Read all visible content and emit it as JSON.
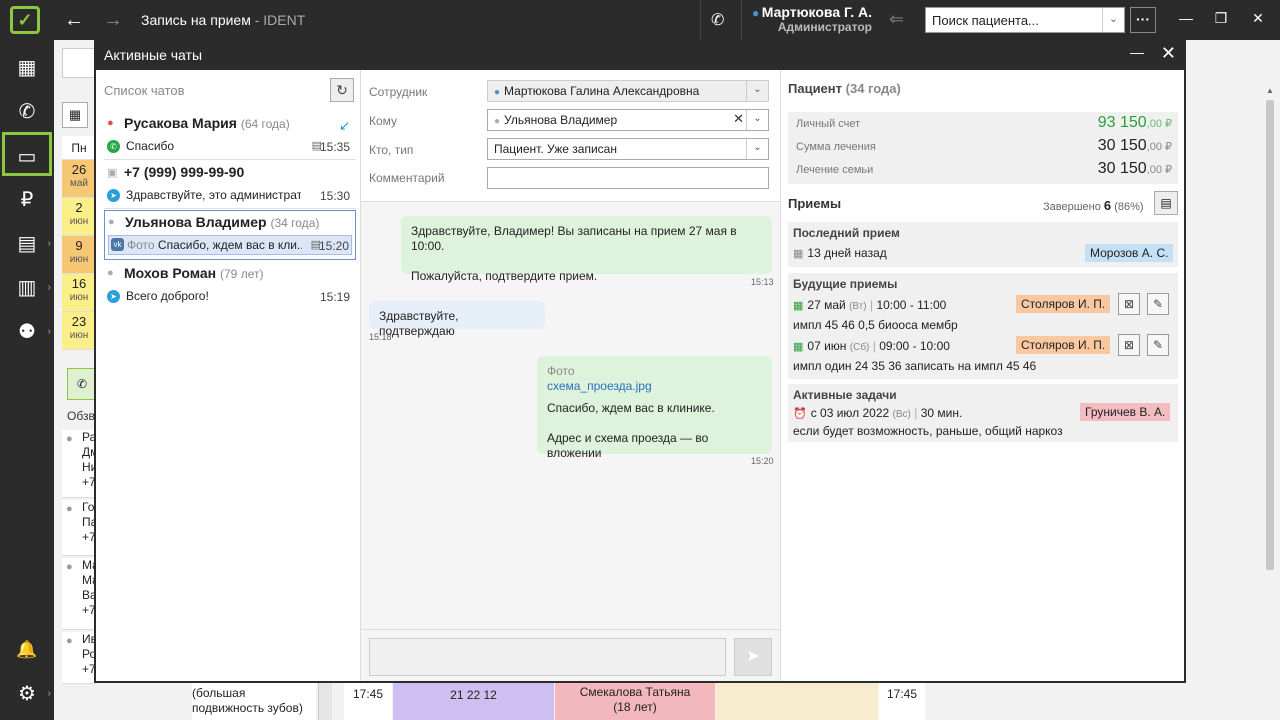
{
  "topbar": {
    "logo": "✓",
    "back_arrow": "←",
    "forward_arrow": "→",
    "title": "Запись на прием",
    "title_sub": " - IDENT",
    "user_name": "Мартюкова Г. А.",
    "user_role": "Администратор",
    "search_placeholder": "Поиск пациента...",
    "more": "···",
    "minimize": "—",
    "restore": "❐",
    "close": "✕"
  },
  "sidebar": {
    "items": [
      {
        "name": "calendar-icon",
        "glyph": "▦"
      },
      {
        "name": "calls-icon",
        "glyph": "✆"
      },
      {
        "name": "chat-icon",
        "glyph": "▭"
      },
      {
        "name": "payments-icon",
        "glyph": "₽"
      },
      {
        "name": "schedule-icon",
        "glyph": "▤"
      },
      {
        "name": "reports-icon",
        "glyph": "▥"
      },
      {
        "name": "users-icon",
        "glyph": "⚉"
      },
      {
        "name": "bell-icon",
        "glyph": "🔔"
      },
      {
        "name": "settings-icon",
        "glyph": "⚙"
      }
    ]
  },
  "background": {
    "week_day_header": "Пн",
    "days": [
      {
        "d": "26",
        "m": "май",
        "color": "#f7c873"
      },
      {
        "d": "2",
        "m": "июн",
        "color": "#fbef8a"
      },
      {
        "d": "9",
        "m": "июн",
        "color": "#f7c873"
      },
      {
        "d": "16",
        "m": "июн",
        "color": "#fbef8a"
      },
      {
        "d": "23",
        "m": "июн",
        "color": "#fbef8a"
      }
    ],
    "overview_label": "Обзв",
    "list_items": [
      {
        "lines": [
          "Ра",
          "Дм",
          "Ни",
          "+7"
        ]
      },
      {
        "lines": [
          "Го",
          "Па",
          "+7"
        ]
      },
      {
        "lines": [
          "Ма",
          "Ма",
          "Ва",
          "+7"
        ]
      },
      {
        "lines": [
          "Ив",
          "Ро",
          "+7"
        ]
      }
    ],
    "bottom_note_1": "(большая",
    "bottom_note_2": "подвижность зубов)",
    "sched_time_1": "17:45",
    "sched_cell_1": "21 22 12",
    "sched_cell_2": "Смекалова Татьяна",
    "sched_cell_2_sub": "(18 лет)",
    "sched_time_2": "17:45"
  },
  "dialog": {
    "title": "Активные чаты",
    "minimize": "—",
    "close": "✕"
  },
  "chat_list": {
    "header": "Список чатов",
    "refresh": "↻",
    "items": [
      {
        "name": "Русакова Мария",
        "age": "(64 года)",
        "channel": "whatsapp",
        "channel_glyph": "✆",
        "message_tag": "",
        "message": "Спасибо",
        "time": "15:35",
        "person_color": "red",
        "has_bubble": true,
        "has_arrow": true
      },
      {
        "name": "+7 (999) 999-99-90",
        "age": "",
        "channel": "telegram",
        "channel_glyph": "➤",
        "message_tag": "",
        "message": "Здравствуйте, это администрато...",
        "time": "15:30",
        "person_color": "gray",
        "has_bubble": false,
        "has_arrow": false
      },
      {
        "name": "Ульянова Владимер",
        "age": "(34 года)",
        "channel": "vk",
        "channel_glyph": "vk",
        "message_tag": "Фото",
        "message": "Спасибо, ждем вас в кли...",
        "time": "15:20",
        "person_color": "gray",
        "has_bubble": true,
        "has_arrow": false
      },
      {
        "name": "Мохов Роман",
        "age": "(79 лет)",
        "channel": "telegram",
        "channel_glyph": "➤",
        "message_tag": "",
        "message": "Всего доброго!",
        "time": "15:19",
        "person_color": "gray",
        "has_bubble": false,
        "has_arrow": false
      }
    ]
  },
  "form": {
    "employee_label": "Сотрудник",
    "employee_value": "Мартюкова Галина Александровна",
    "to_label": "Кому",
    "to_value": "Ульянова Владимер",
    "type_label": "Кто, тип",
    "type_value": "Пациент. Уже записан",
    "comment_label": "Комментарий",
    "comment_value": ""
  },
  "messages": [
    {
      "dir": "out",
      "paras": [
        "Здравствуйте, Владимер! Вы записаны на прием 27 мая в 10:00.",
        "Пожалуйста, подтвердите прием."
      ],
      "time": "15:13"
    },
    {
      "dir": "in",
      "paras": [
        "Здравствуйте, подтверждаю"
      ],
      "time": "15:18"
    },
    {
      "dir": "out",
      "photo_label": "Фото",
      "link": "схема_проезда.jpg",
      "paras": [
        "Спасибо, ждем вас в клинике.",
        "Адрес и схема проезда — во вложении"
      ],
      "time": "15:20"
    }
  ],
  "composer": {
    "send": "➤"
  },
  "patient": {
    "title": "Пациент",
    "age": "(34 года)",
    "account": [
      {
        "label": "Личный счет",
        "value": "93 150",
        "cents": ",00 ₽",
        "green": true
      },
      {
        "label": "Сумма лечения",
        "value": "30 150",
        "cents": ",00 ₽",
        "green": false
      },
      {
        "label": "Лечение семьи",
        "value": "30 150",
        "cents": ",00 ₽",
        "green": false
      }
    ],
    "appointments_title": "Приемы",
    "completed_label": "Завершено",
    "completed_count": "6",
    "completed_pct": "(86%)",
    "last_title": "Последний прием",
    "last_when": "13 дней назад",
    "last_doctor": "Морозов А. С.",
    "future_title": "Будущие приемы",
    "future": [
      {
        "date": "27 май",
        "dow": "(Вт)",
        "time": "10:00 - 11:00",
        "doctor": "Столяров И. П.",
        "note": "импл 45 46 0,5 биооса  мембр"
      },
      {
        "date": "07 июн",
        "dow": "(Сб)",
        "time": "09:00 - 10:00",
        "doctor": "Столяров И. П.",
        "note": "импл один 24 35 36 записать на импл 45 46"
      }
    ],
    "tasks_title": "Активные задачи",
    "task_when": "с 03 июл 2022",
    "task_dow": "(Вс)",
    "task_duration": "30 мин.",
    "task_doctor": "Груничев В. А.",
    "task_note": "если будет возможность, раньше, общий наркоз"
  },
  "colors": {
    "accent": "#8dc63f",
    "dark": "#2b2b2b",
    "green_text": "#2a9d3a",
    "out_bubble": "#ddf3dc",
    "in_bubble": "#e6eef7"
  }
}
